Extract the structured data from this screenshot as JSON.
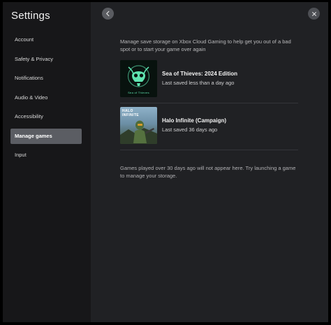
{
  "app": {
    "title": "Settings"
  },
  "sidebar": {
    "items": [
      {
        "label": "Account",
        "active": false
      },
      {
        "label": "Safety & Privacy",
        "active": false
      },
      {
        "label": "Notifications",
        "active": false
      },
      {
        "label": "Audio & Video",
        "active": false
      },
      {
        "label": "Accessibility",
        "active": false
      },
      {
        "label": "Manage games",
        "active": true
      },
      {
        "label": "Input",
        "active": false
      }
    ]
  },
  "main": {
    "description": "Manage save storage on Xbox Cloud Gaming to help get you out of a bad spot or to start your game over again",
    "games": [
      {
        "title": "Sea of Thieves: 2024 Edition",
        "subtitle": "Last saved less than a day ago",
        "art_text": "Sea of Thieves",
        "icon": "skull-emblem"
      },
      {
        "title": "Halo Infinite (Campaign)",
        "subtitle": "Last saved 36 days ago",
        "art_text": "HALO INFINITE",
        "icon": "spartan-art"
      }
    ],
    "note": "Games played over 30 days ago will not appear here. Try launching a game to manage your storage."
  },
  "icons": {
    "back": "chevron-left-icon",
    "close": "close-icon"
  },
  "colors": {
    "window": "#202124",
    "sidebar": "#171719",
    "active_item": "#5b5d63",
    "accent_green": "#5fe3b0"
  }
}
